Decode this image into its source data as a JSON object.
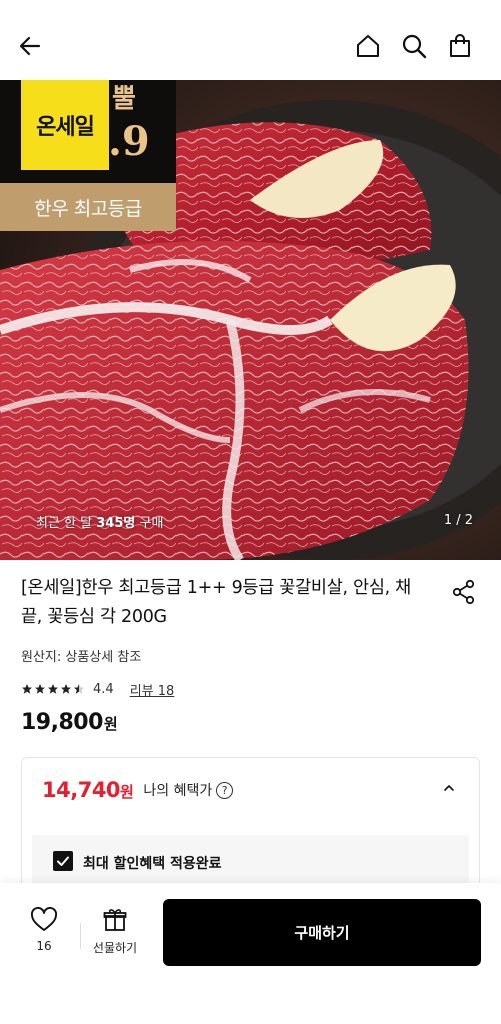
{
  "header": {
    "back_icon": "arrow-left-icon",
    "home_icon": "home-icon",
    "search_icon": "search-icon",
    "bag_icon": "shopping-bag-icon"
  },
  "hero": {
    "badge_sale": "온세일",
    "badge_price_top": "뿔",
    "badge_price_bottom": ".9",
    "badge_grade": "한우 최고등급",
    "caption_prefix": "최근 한 달 ",
    "caption_count": "345명",
    "caption_suffix": " 구매",
    "page_indicator": "1 / 2"
  },
  "product": {
    "title": "[온세일]한우 최고등급 1++ 9등급 꽃갈비살, 안심, 채끝, 꽃등심 각 200G",
    "origin": "원산지: 상품상세 참조",
    "rating": "4.4",
    "rating_value": 4.4,
    "review_label": "리뷰 18",
    "price": "19,800",
    "price_unit": "원"
  },
  "benefit": {
    "price": "14,740",
    "unit": "원",
    "label": "나의 혜택가",
    "help_glyph": "?",
    "checkbox_label": "최대 할인혜택 적용완료"
  },
  "bottom_bar": {
    "like_count": "16",
    "gift_label": "선물하기",
    "buy_label": "구매하기"
  },
  "colors": {
    "benefit_price": "#e4202f",
    "grade_badge": "#bf9d6c",
    "sale_badge": "#f6df1a",
    "buy_button": "#000000"
  }
}
